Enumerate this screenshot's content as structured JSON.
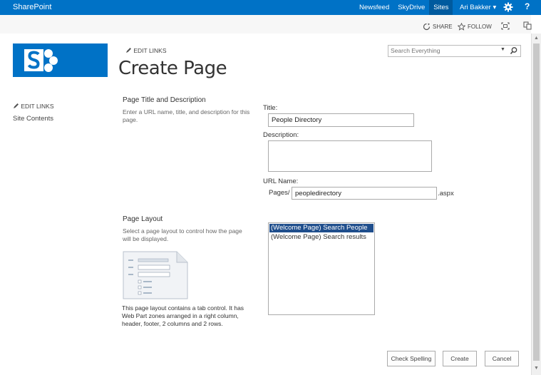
{
  "topbar": {
    "brand": "SharePoint",
    "nav": [
      "Newsfeed",
      "SkyDrive",
      "Sites"
    ],
    "active": "Sites",
    "user": "Ari Bakker",
    "user_caret": "▾",
    "help": "?"
  },
  "actions": {
    "share": "SHARE",
    "follow": "FOLLOW"
  },
  "header": {
    "edit_links": "EDIT LINKS",
    "page_title": "Create Page",
    "search_placeholder": "Search Everything"
  },
  "leftnav": {
    "edit_links": "EDIT LINKS",
    "site_contents": "Site Contents"
  },
  "section_title": {
    "heading": "Page Title and Description",
    "description": "Enter a URL name, title, and description for this page."
  },
  "form": {
    "title_label": "Title:",
    "title_value": "People Directory",
    "description_label": "Description:",
    "description_value": "",
    "url_label": "URL Name:",
    "url_prefix": "Pages/",
    "url_value": "peopledirectory",
    "url_suffix": ".aspx"
  },
  "section_layout": {
    "heading": "Page Layout",
    "description": "Select a page layout to control how the page will be displayed.",
    "layout_description": "This page layout contains a tab control.  It has Web Part zones arranged in a right column, header, footer, 2 columns and 2 rows."
  },
  "layouts": {
    "options": [
      "(Welcome Page) Search People",
      "(Welcome Page) Search results"
    ],
    "selected_index": 0
  },
  "buttons": {
    "check_spelling": "Check Spelling",
    "create": "Create",
    "cancel": "Cancel"
  },
  "colors": {
    "suite_bar": "#0072c6",
    "active_tab": "#005a9e",
    "selection": "#1f4e8c",
    "logo": "#0072c6"
  }
}
